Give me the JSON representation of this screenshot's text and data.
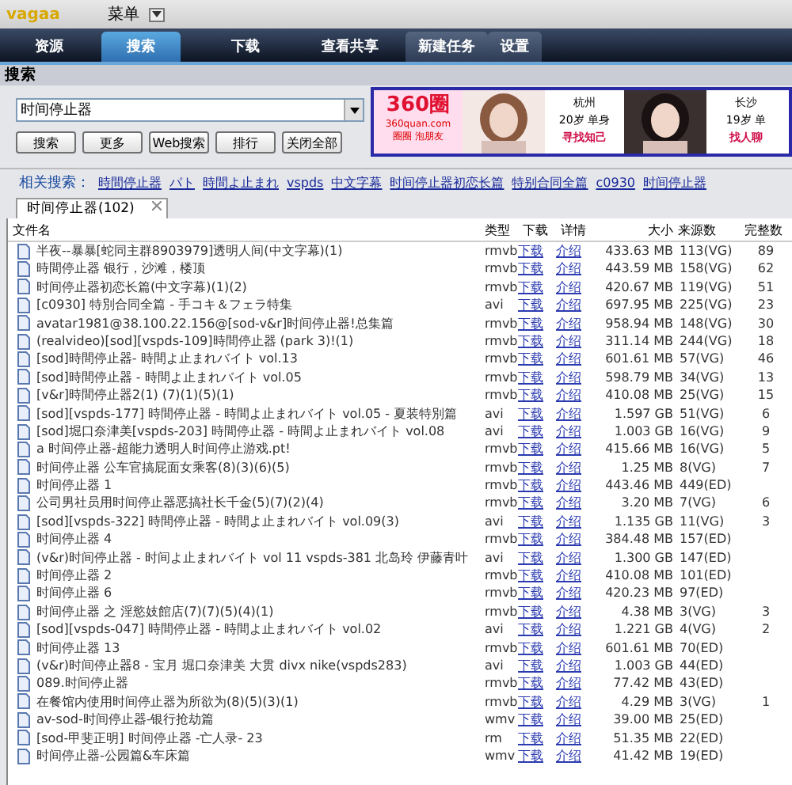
{
  "app": {
    "logo": "vagaa",
    "menu": "菜单"
  },
  "tabs": [
    {
      "label": "资源",
      "selected": false
    },
    {
      "label": "搜索",
      "selected": true
    },
    {
      "label": "下载",
      "selected": false
    },
    {
      "label": "查看共享",
      "selected": false
    }
  ],
  "tab_actions": [
    {
      "label": "新建任务"
    },
    {
      "label": "设置"
    }
  ],
  "section_title": "搜索",
  "search": {
    "value": "时间停止器",
    "buttons": [
      "搜索",
      "更多",
      "Web搜索",
      "排行",
      "关闭全部"
    ]
  },
  "ad": {
    "logo": "360圈",
    "site": "360quan.com",
    "slogan": "圈圈 泡朋友",
    "cards": [
      {
        "city": "杭州",
        "info": "20岁 单身",
        "action": "寻找知己"
      },
      {
        "city": "长沙",
        "info": "19岁 单",
        "action": "找人聊"
      }
    ]
  },
  "related": {
    "label": "相关搜索：",
    "links": [
      "時間停止器",
      "パト",
      "時間よ止まれ",
      "vspds",
      "中文字幕",
      "时间停止器初恋长篇",
      "特别合同全篇",
      "c0930",
      "时间停止器"
    ]
  },
  "result_tabs": [
    {
      "label": "时间停止器(102)",
      "selected": true
    }
  ],
  "table": {
    "columns": [
      "文件名",
      "类型",
      "下载",
      "详情",
      "大小",
      "来源数",
      "完整数"
    ],
    "rows": [
      {
        "name": "半夜--暴暴[蛇同主群8903979]透明人间(中文字幕)(1)",
        "type": "rmvb",
        "download": "下载",
        "detail": "介绍",
        "size": "433.63 MB",
        "sources": "113(VG)",
        "complete": "89"
      },
      {
        "name": "時間停止器 银行，沙滩，楼顶",
        "type": "rmvb",
        "download": "下载",
        "detail": "介绍",
        "size": "443.59 MB",
        "sources": "158(VG)",
        "complete": "62"
      },
      {
        "name": "时间停止器初恋长篇(中文字幕)(1)(2)",
        "type": "rmvb",
        "download": "下载",
        "detail": "介绍",
        "size": "420.67 MB",
        "sources": "119(VG)",
        "complete": "51"
      },
      {
        "name": "[c0930] 特別合同全篇 - 手コキ＆フェラ特集",
        "type": "avi",
        "download": "下载",
        "detail": "介绍",
        "size": "697.95 MB",
        "sources": "225(VG)",
        "complete": "23"
      },
      {
        "name": "avatar1981@38.100.22.156@[sod-v&r]时间停止器!总集篇",
        "type": "rmvb",
        "download": "下载",
        "detail": "介绍",
        "size": "958.94 MB",
        "sources": "148(VG)",
        "complete": "30"
      },
      {
        "name": "(realvideo)[sod][vspds-109]時間停止器 (park 3)!(1)",
        "type": "rmvb",
        "download": "下载",
        "detail": "介绍",
        "size": "311.14 MB",
        "sources": "244(VG)",
        "complete": "18"
      },
      {
        "name": "[sod]時間停止器- 時間よ止まれバイト vol.13",
        "type": "rmvb",
        "download": "下载",
        "detail": "介绍",
        "size": "601.61 MB",
        "sources": "57(VG)",
        "complete": "46"
      },
      {
        "name": "[sod]時間停止器 - 時間よ止まれバイト vol.05",
        "type": "rmvb",
        "download": "下载",
        "detail": "介绍",
        "size": "598.79 MB",
        "sources": "34(VG)",
        "complete": "13"
      },
      {
        "name": "[v&r]時間停止器2(1) (7)(1)(5)(1)",
        "type": "rmvb",
        "download": "下载",
        "detail": "介绍",
        "size": "410.08 MB",
        "sources": "25(VG)",
        "complete": "15"
      },
      {
        "name": "[sod][vspds-177] 時間停止器 - 時間よ止まれバイト vol.05 - 夏装特別篇",
        "type": "avi",
        "download": "下载",
        "detail": "介绍",
        "size": "1.597 GB",
        "sources": "51(VG)",
        "complete": "6"
      },
      {
        "name": "[sod]堀口奈津美[vspds-203] 時間停止器 - 時間よ止まれバイト vol.08",
        "type": "avi",
        "download": "下载",
        "detail": "介绍",
        "size": "1.003 GB",
        "sources": "16(VG)",
        "complete": "9"
      },
      {
        "name": "a 时间停止器-超能力透明人时间停止游戏.pt!",
        "type": "rmvb",
        "download": "下载",
        "detail": "介绍",
        "size": "415.66 MB",
        "sources": "16(VG)",
        "complete": "5"
      },
      {
        "name": "时间停止器 公车官搞屁面女乘客(8)(3)(6)(5)",
        "type": "rmvb",
        "download": "下载",
        "detail": "介绍",
        "size": "1.25 MB",
        "sources": "8(VG)",
        "complete": "7"
      },
      {
        "name": "时间停止器 1",
        "type": "rmvb",
        "download": "下载",
        "detail": "介绍",
        "size": "443.46 MB",
        "sources": "449(ED)"
      },
      {
        "name": "公司男社员用时间停止器恶搞社长千金(5)(7)(2)(4)",
        "type": "rmvb",
        "download": "下载",
        "detail": "介绍",
        "size": "3.20 MB",
        "sources": "7(VG)",
        "complete": "6"
      },
      {
        "name": "[sod][vspds-322] 時間停止器 - 時間よ止まれバイト vol.09(3)",
        "type": "avi",
        "download": "下载",
        "detail": "介绍",
        "size": "1.135 GB",
        "sources": "11(VG)",
        "complete": "3"
      },
      {
        "name": "时间停止器 4",
        "type": "rmvb",
        "download": "下载",
        "detail": "介绍",
        "size": "384.48 MB",
        "sources": "157(ED)"
      },
      {
        "name": "(v&r)时间停止器 - 时间よ止まれバイト vol 11 vspds-381 北岛玲 伊藤青叶",
        "type": "avi",
        "download": "下载",
        "detail": "介绍",
        "size": "1.300 GB",
        "sources": "147(ED)"
      },
      {
        "name": "时间停止器 2",
        "type": "rmvb",
        "download": "下载",
        "detail": "介绍",
        "size": "410.08 MB",
        "sources": "101(ED)"
      },
      {
        "name": "时间停止器 6",
        "type": "rmvb",
        "download": "下载",
        "detail": "介绍",
        "size": "420.23 MB",
        "sources": "97(ED)"
      },
      {
        "name": "时间停止器 之 淫慾妓館店(7)(7)(5)(4)(1)",
        "type": "rmvb",
        "download": "下载",
        "detail": "介绍",
        "size": "4.38 MB",
        "sources": "3(VG)",
        "complete": "3"
      },
      {
        "name": "[sod][vspds-047] 時間停止器 - 時間よ止まれバイト vol.02",
        "type": "avi",
        "download": "下载",
        "detail": "介绍",
        "size": "1.221 GB",
        "sources": "4(VG)",
        "complete": "2"
      },
      {
        "name": "时间停止器 13",
        "type": "rmvb",
        "download": "下载",
        "detail": "介绍",
        "size": "601.61 MB",
        "sources": "70(ED)"
      },
      {
        "name": "(v&r)时间停止器8 - 宝月 堀口奈津美 大贯 divx nike(vspds283)",
        "type": "avi",
        "download": "下载",
        "detail": "介绍",
        "size": "1.003 GB",
        "sources": "44(ED)"
      },
      {
        "name": "089.时间停止器",
        "type": "rmvb",
        "download": "下载",
        "detail": "介绍",
        "size": "77.42 MB",
        "sources": "43(ED)"
      },
      {
        "name": "在餐馆内使用时间停止器为所欲为(8)(5)(3)(1)",
        "type": "rmvb",
        "download": "下载",
        "detail": "介绍",
        "size": "4.29 MB",
        "sources": "3(VG)",
        "complete": "1"
      },
      {
        "name": "av-sod-时间停止器-银行抢劫篇",
        "type": "wmv",
        "download": "下载",
        "detail": "介绍",
        "size": "39.00 MB",
        "sources": "25(ED)"
      },
      {
        "name": "[sod-甲斐正明] 时间停止器 -亡人录- 23",
        "type": "rm",
        "download": "下载",
        "detail": "介绍",
        "size": "51.35 MB",
        "sources": "22(ED)"
      },
      {
        "name": "时间停止器-公园篇&车床篇",
        "type": "wmv",
        "download": "下载",
        "detail": "介绍",
        "size": "41.42 MB",
        "sources": "19(ED)"
      }
    ]
  }
}
